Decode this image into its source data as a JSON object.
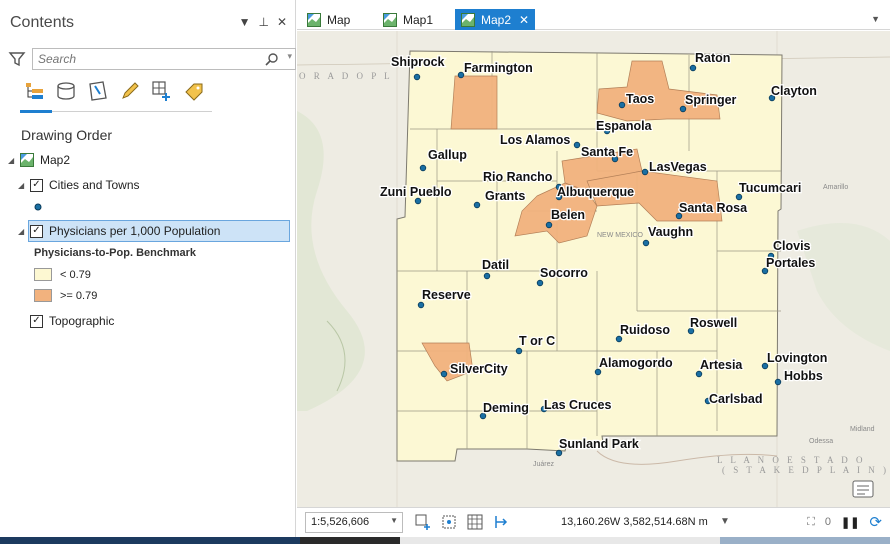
{
  "contents": {
    "title": "Contents",
    "search_placeholder": "Search",
    "drawing_order_heading": "Drawing Order",
    "layers": {
      "map": "Map2",
      "cities": "Cities and Towns",
      "physicians": "Physicians per 1,000 Population",
      "benchmark_heading": "Physicians-to-Pop. Benchmark",
      "legend_low": "< 0.79",
      "legend_high": ">= 0.79",
      "topographic": "Topographic"
    },
    "colors": {
      "low": "#fdf8d2",
      "high": "#f2b27e",
      "selection": "#cde3f7"
    }
  },
  "tabs": [
    {
      "label": "Map",
      "active": false
    },
    {
      "label": "Map1",
      "active": false
    },
    {
      "label": "Map2",
      "active": true
    }
  ],
  "map": {
    "cities": [
      "Shiprock",
      "Farmington",
      "Raton",
      "Clayton",
      "Taos",
      "Springer",
      "Espanola",
      "Los Alamos",
      "Gallup",
      "Santa Fe",
      "LasVegas",
      "Rio Rancho",
      "Zuni Pueblo",
      "Grants",
      "Albuquerque",
      "Tucumcari",
      "Belen",
      "Santa Rosa",
      "Vaughn",
      "Clovis",
      "Datil",
      "Portales",
      "Socorro",
      "Reserve",
      "Roswell",
      "Ruidoso",
      "T or C",
      "Lovington",
      "Alamogordo",
      "Artesia",
      "SilverCity",
      "Hobbs",
      "Carlsbad",
      "Deming",
      "Las Cruces",
      "Sunland Park"
    ],
    "basemap_labels": {
      "colorado": "O R A D O  P L",
      "llano": "L L A N O   E S T A D O",
      "staked": "( S T A K E D   P L A I N )",
      "new_mexico": "NEW MEXICO",
      "amarillo": "Amarillo",
      "odessa": "Odessa",
      "midland": "Midland",
      "juarez": "Juárez"
    }
  },
  "status": {
    "scale": "1:5,526,606",
    "coordinates": "13,160.26W 3,582,514.68N m",
    "selected_count": "0"
  }
}
